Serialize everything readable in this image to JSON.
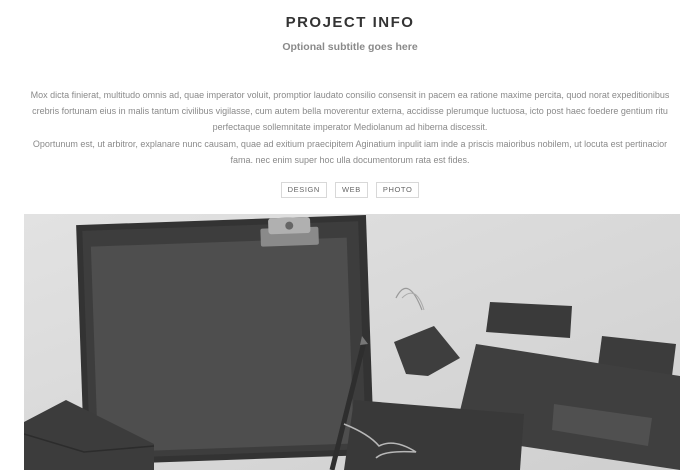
{
  "header": {
    "title": "PROJECT INFO",
    "subtitle": "Optional subtitle goes here"
  },
  "description": {
    "paragraph_1": "Mox dicta finierat, multitudo omnis ad, quae imperator voluit, promptior laudato consilio consensit in pacem ea ratione maxime percita, quod norat expeditionibus crebris fortunam eius in malis tantum civilibus vigilasse, cum autem bella moverentur externa, accidisse plerumque luctuosa, icto post haec foedere gentium ritu perfectaque sollemnitate imperator Mediolanum ad hiberna discessit.",
    "paragraph_2": "Oportunum est, ut arbitror, explanare nunc causam, quae ad exitium praecipitem Aginatium inpulit iam inde a priscis maioribus nobilem, ut locuta est pertinacior fama. nec enim super hoc ulla documentorum rata est fides."
  },
  "tags": [
    {
      "label": "DESIGN"
    },
    {
      "label": "WEB"
    },
    {
      "label": "PHOTO"
    }
  ],
  "hero_image": {
    "description": "stationery-mockup-photo",
    "colors": {
      "background": "#d9d9d9",
      "object_dark": "#3a3a3a",
      "object_mid": "#4a4a4a",
      "paper": "#555555"
    }
  }
}
